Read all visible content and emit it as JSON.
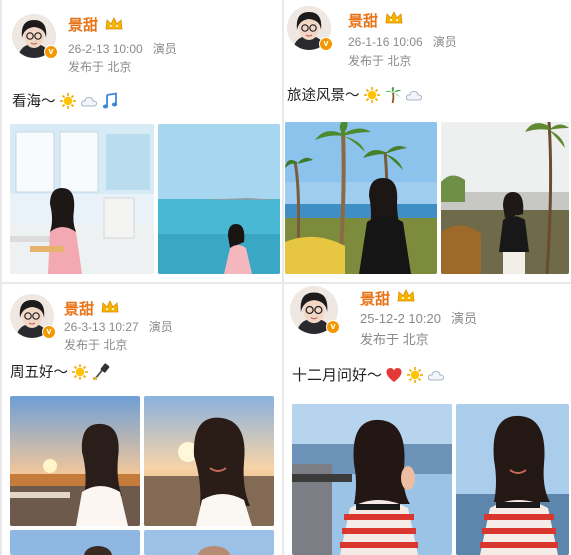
{
  "posts": [
    {
      "author": "景甜",
      "timestamp": "26-2-13 10:00",
      "role": "演员",
      "location": "发布于 北京",
      "text": "看海～",
      "emojis": [
        "sun-icon",
        "cloud-icon",
        "music-note-icon"
      ],
      "photos": [
        "beach-terrace-photo",
        "sea-view-photo"
      ]
    },
    {
      "author": "景甜",
      "timestamp": "26-1-16 10:06",
      "role": "演员",
      "location": "发布于 北京",
      "text": "旅途风景～",
      "emojis": [
        "sun-icon",
        "palm-tree-icon",
        "cloud-icon"
      ],
      "photos": [
        "palm-garden-photo",
        "sunset-garden-photo"
      ]
    },
    {
      "author": "景甜",
      "timestamp": "26-3-13 10:27",
      "role": "演员",
      "location": "发布于 北京",
      "text": "周五好～",
      "emojis": [
        "sun-icon",
        "selfie-stick-icon"
      ],
      "photos": [
        "sunset-selfie-photo",
        "sunset-closeup-photo"
      ]
    },
    {
      "author": "景甜",
      "timestamp": "25-12-2 10:20",
      "role": "演员",
      "location": "发布于 北京",
      "text": "十二月问好～",
      "emojis": [
        "heart-icon",
        "sun-icon",
        "cloud-icon"
      ],
      "photos": [
        "striped-shirt-photo",
        "striped-shirt-closeup-photo"
      ]
    }
  ],
  "colors": {
    "author_name": "#e8741a",
    "verified_badge": "#f39800",
    "meta_text": "#8a8a8a",
    "background": "#e9e9ec"
  }
}
